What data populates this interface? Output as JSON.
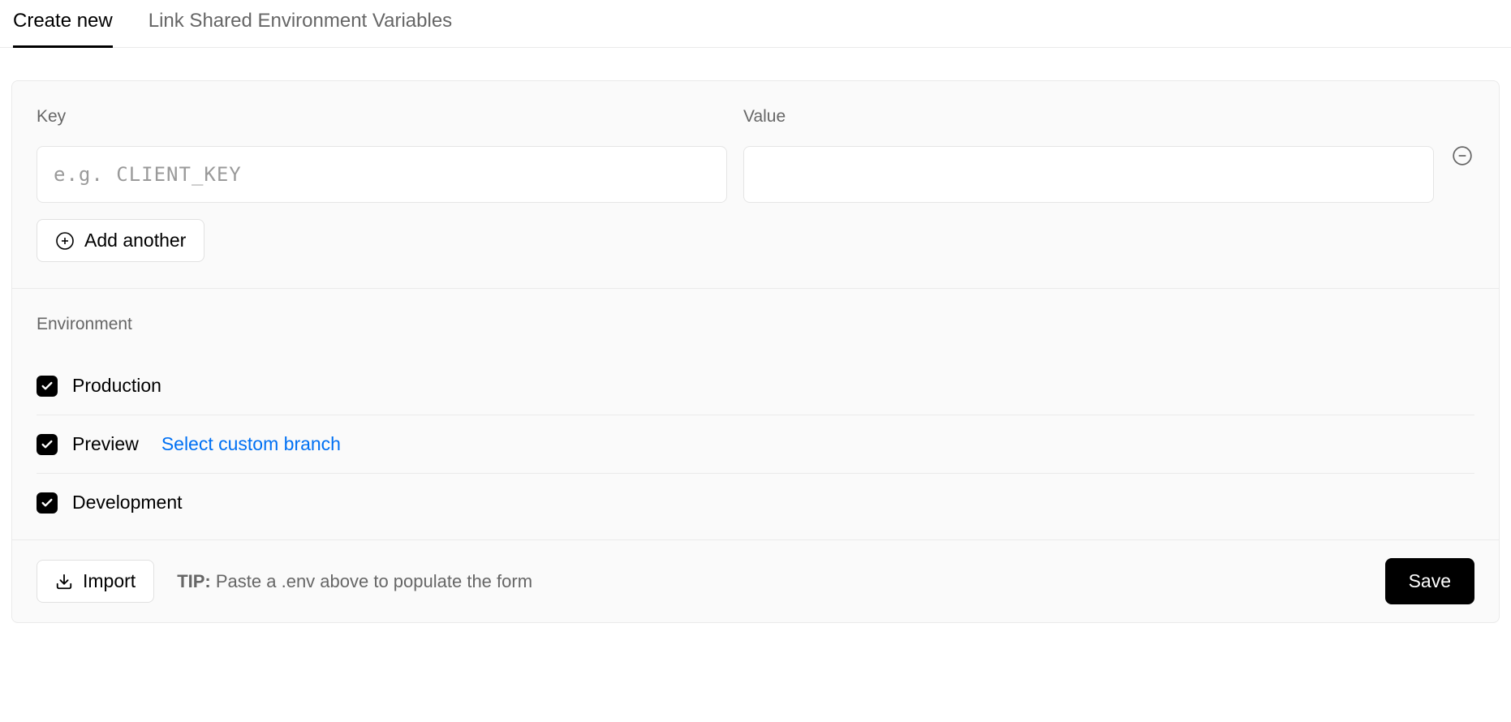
{
  "tabs": {
    "create": "Create new",
    "link": "Link Shared Environment Variables"
  },
  "form": {
    "keyLabel": "Key",
    "valueLabel": "Value",
    "keyPlaceholder": "e.g. CLIENT_KEY",
    "addAnother": "Add another"
  },
  "env": {
    "heading": "Environment",
    "items": [
      {
        "label": "Production",
        "checked": true
      },
      {
        "label": "Preview",
        "checked": true,
        "extra": "Select custom branch"
      },
      {
        "label": "Development",
        "checked": true
      }
    ]
  },
  "footer": {
    "import": "Import",
    "tipLabel": "TIP:",
    "tipText": "Paste a .env above to populate the form",
    "save": "Save"
  }
}
